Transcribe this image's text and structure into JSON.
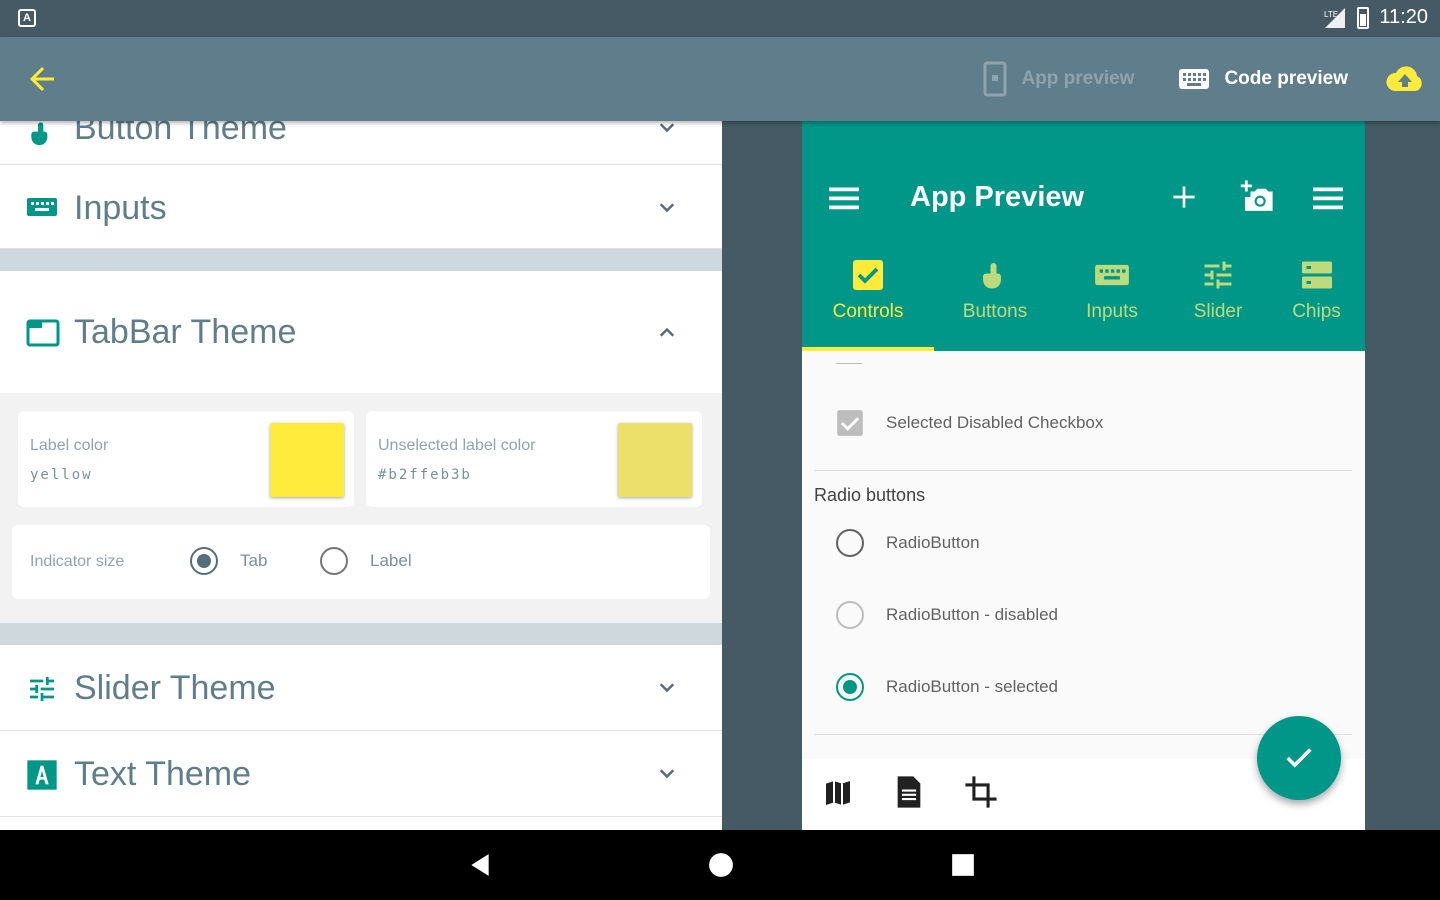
{
  "status_bar": {
    "time": "11:20",
    "network": "LTE"
  },
  "app_bar": {
    "actions": [
      {
        "label": "App preview",
        "state": "disabled",
        "icon": "tablet-icon"
      },
      {
        "label": "Code preview",
        "state": "active",
        "icon": "keyboard-icon"
      }
    ],
    "cloud_icon": "cloud-upload-icon"
  },
  "left_panel": {
    "sections": {
      "button_theme": "Button Theme",
      "inputs": "Inputs",
      "tabbar_theme": "TabBar Theme",
      "slider_theme": "Slider Theme",
      "text_theme": "Text Theme"
    },
    "tabbar": {
      "label_color": {
        "label": "Label color",
        "value": "yellow",
        "color": "#ffeb3b"
      },
      "unselected_label_color": {
        "label": "Unselected label color",
        "value": "#b2ffeb3b",
        "color": "#ece06a"
      },
      "indicator_size": {
        "label": "Indicator size",
        "options": [
          "Tab",
          "Label"
        ],
        "selected": "Tab"
      }
    }
  },
  "preview": {
    "title": "App Preview",
    "tabs": [
      {
        "label": "Controls",
        "icon": "checkbox-icon",
        "selected": true
      },
      {
        "label": "Buttons",
        "icon": "touch-icon",
        "selected": false
      },
      {
        "label": "Inputs",
        "icon": "keyboard-icon",
        "selected": false
      },
      {
        "label": "Slider",
        "icon": "tune-icon",
        "selected": false
      },
      {
        "label": "Chips",
        "icon": "chips-icon",
        "selected": false
      }
    ],
    "checkbox_label": "Selected Disabled Checkbox",
    "radio_header": "Radio buttons",
    "radios": [
      {
        "label": "RadioButton",
        "state": "normal"
      },
      {
        "label": "RadioButton - disabled",
        "state": "disabled"
      },
      {
        "label": "RadioButton - selected",
        "state": "selected"
      }
    ],
    "bottom_icons": [
      "map-icon",
      "document-icon",
      "crop-icon"
    ]
  },
  "colors": {
    "primary": "#009688",
    "accent": "#ffeb3b",
    "app_bar": "#607d8b",
    "background": "#455a64"
  }
}
